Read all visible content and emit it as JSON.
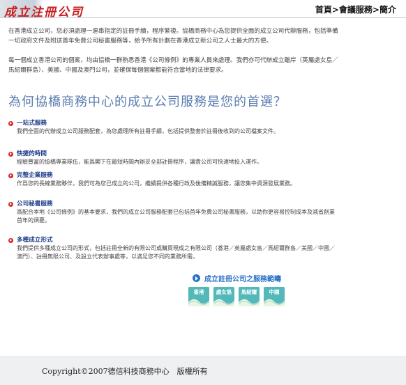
{
  "header": {
    "title": "成立注冊公司",
    "breadcrumb": [
      "首頁",
      "會議服務",
      "簡介"
    ],
    "separator": ">"
  },
  "intro": {
    "p1": "在香港成立公司，您必須處理一連串指定的註冊手續，程序繁複。協橋商務中心為您提供全面的成立公司代辦服務，包括準備一切政府文件及附送首年免費公司秘書服務等，給予所有計劃在香港成立新公司之人士最大的方便。",
    "p2": "每一個成立香港公司的個案，均由協橋一群熟悉香港《公司條例》的專業人員來處理。我們亦可代辦成立離岸（英屬處女島／馬紹爾群島）、美國、中國及澳門公司，並確保每個個案都能符合當地的法律要求。"
  },
  "heading": "為何協橋商務中心的成立公司服務是您的首選？",
  "features": [
    {
      "title": "一站式服務",
      "desc": "我們全面的代辦成立公司服務配套，為您處理所有註冊手續，包括提供整套於註冊後收到的公司檔案文件。"
    },
    {
      "title": "快捷的時間",
      "desc": "經驗豐富的協橋專業隊伍，能爲閣下在最短時間內辦妥全部註冊程序，讓貴公司可快速地投入運作。"
    },
    {
      "title": "完整企業服務",
      "desc": "作爲您的長線業務夥伴，我們可為您已成立的公司，繼續提供各種行政及後備精誠服務，讓您集中資源發展業務。"
    },
    {
      "title": "公司秘書服務",
      "desc": "爲配合本地《公司條例》的基本要求，我們的成立公司服務配套已包括首年免費公司秘書服務，以助你更容易控制成本及減省創業首年的煩憂。"
    },
    {
      "title": "多種成立形式",
      "desc": "我們提供多種成立公司的形式，包括註冊全新的有限公司或購買現成之有限公司（香港／英屬處女島／馬紹爾群島／美國／中國／澳門）、註冊無限公司、及設立代表辦事處等，以滿足您不同的業務所需。"
    }
  ],
  "services_link": "成立註冊公司之服務範疇",
  "regions": [
    "香港",
    "處女島",
    "馬紹爾",
    "中國"
  ],
  "footer": {
    "copyright": "Copyright©2007德信科技商務中心　版權所有"
  },
  "colors": {
    "title": "#c81e1e",
    "heading": "#5a7bb0",
    "feature_title": "#1c3e8a",
    "bullet": "#d92424",
    "link": "#2a72c8",
    "region_tile": "#52b8ba",
    "footer_bg": "#eef0f2"
  }
}
